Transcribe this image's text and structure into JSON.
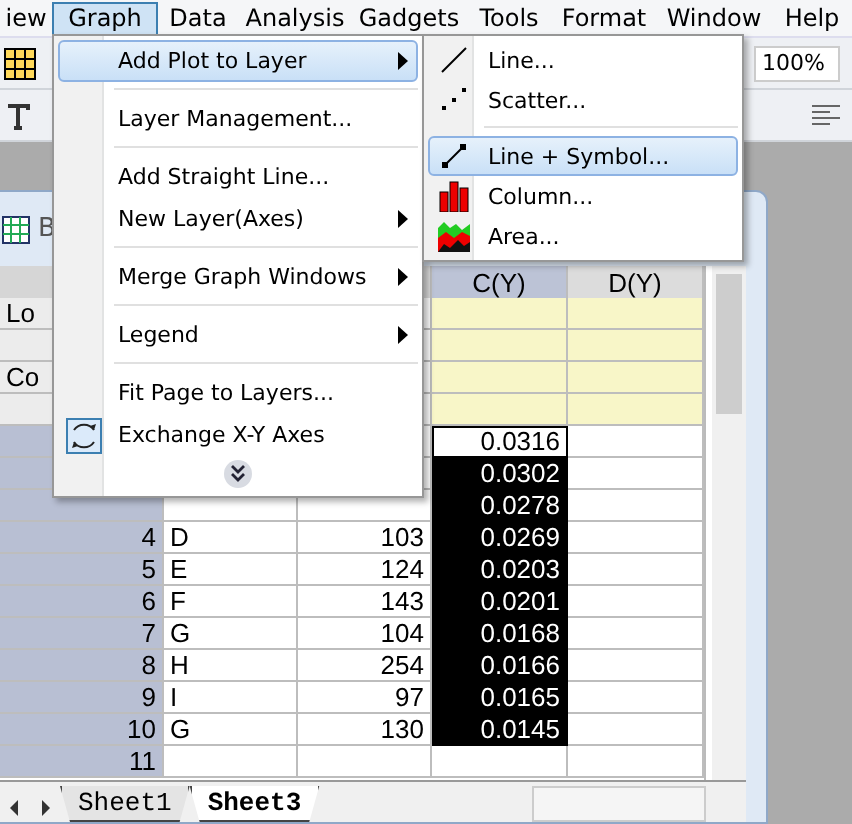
{
  "menubar": [
    {
      "label": "iew",
      "selected": false
    },
    {
      "label": "Graph",
      "selected": true
    },
    {
      "label": "Data",
      "selected": false
    },
    {
      "label": "Analysis",
      "selected": false
    },
    {
      "label": "Gadgets",
      "selected": false
    },
    {
      "label": "Tools",
      "selected": false
    },
    {
      "label": "Format",
      "selected": false
    },
    {
      "label": "Window",
      "selected": false
    },
    {
      "label": "Help",
      "selected": false
    }
  ],
  "toolbar": {
    "zoom": "100%"
  },
  "graph_menu": {
    "items": [
      {
        "kind": "command",
        "label": "Add Plot to Layer",
        "selected": true,
        "submenu": true
      },
      {
        "kind": "separator"
      },
      {
        "kind": "command",
        "label": "Layer Management...",
        "selected": false,
        "submenu": false
      },
      {
        "kind": "separator"
      },
      {
        "kind": "command",
        "label": "Add Straight Line...",
        "selected": false,
        "submenu": false
      },
      {
        "kind": "command",
        "label": "New Layer(Axes)",
        "selected": false,
        "submenu": true
      },
      {
        "kind": "separator"
      },
      {
        "kind": "command",
        "label": "Merge Graph Windows",
        "selected": false,
        "submenu": true
      },
      {
        "kind": "separator"
      },
      {
        "kind": "command",
        "label": "Legend",
        "selected": false,
        "submenu": true
      },
      {
        "kind": "separator"
      },
      {
        "kind": "command",
        "label": "Fit Page to Layers...",
        "selected": false,
        "submenu": false
      },
      {
        "kind": "swap",
        "label": "Exchange X-Y Axes",
        "selected": false,
        "submenu": false
      }
    ]
  },
  "plot_submenu": {
    "items": [
      {
        "kind": "line",
        "label": "Line...",
        "selected": false
      },
      {
        "kind": "scatter",
        "label": "Scatter...",
        "selected": false
      },
      {
        "kind": "separator"
      },
      {
        "kind": "linesymbol",
        "label": "Line + Symbol...",
        "selected": true
      },
      {
        "kind": "column",
        "label": "Column...",
        "selected": false
      },
      {
        "kind": "area",
        "label": "Area...",
        "selected": false
      }
    ]
  },
  "worksheet": {
    "title": "B",
    "label_rows": [
      "Lo",
      null,
      "Co",
      null
    ],
    "column_headers": {
      "column_3": {
        "header": "C(Y)",
        "selected": true
      },
      "column_4": {
        "header": "D(Y)",
        "selected": false
      }
    },
    "rows": [
      {
        "column_3": "0.0316",
        "selected": false
      },
      {
        "column_3": "0.0302",
        "selected": true
      },
      {
        "column_3": "0.0278",
        "selected": true
      },
      {
        "number": "4",
        "column_1": "D",
        "column_2": "103",
        "column_3": "0.0269",
        "selected": true
      },
      {
        "number": "5",
        "column_1": "E",
        "column_2": "124",
        "column_3": "0.0203",
        "selected": true
      },
      {
        "number": "6",
        "column_1": "F",
        "column_2": "143",
        "column_3": "0.0201",
        "selected": true
      },
      {
        "number": "7",
        "column_1": "G",
        "column_2": "104",
        "column_3": "0.0168",
        "selected": true
      },
      {
        "number": "8",
        "column_1": "H",
        "column_2": "254",
        "column_3": "0.0166",
        "selected": true
      },
      {
        "number": "9",
        "column_1": "I",
        "column_2": "97",
        "column_3": "0.0165",
        "selected": true
      },
      {
        "number": "10",
        "column_1": "G",
        "column_2": "130",
        "column_3": "0.0145",
        "selected": true
      },
      {
        "number": "11",
        "selected": false
      }
    ],
    "tabs": [
      {
        "label": "Sheet1",
        "selected": false
      },
      {
        "label": "Sheet3",
        "selected": true
      }
    ]
  }
}
